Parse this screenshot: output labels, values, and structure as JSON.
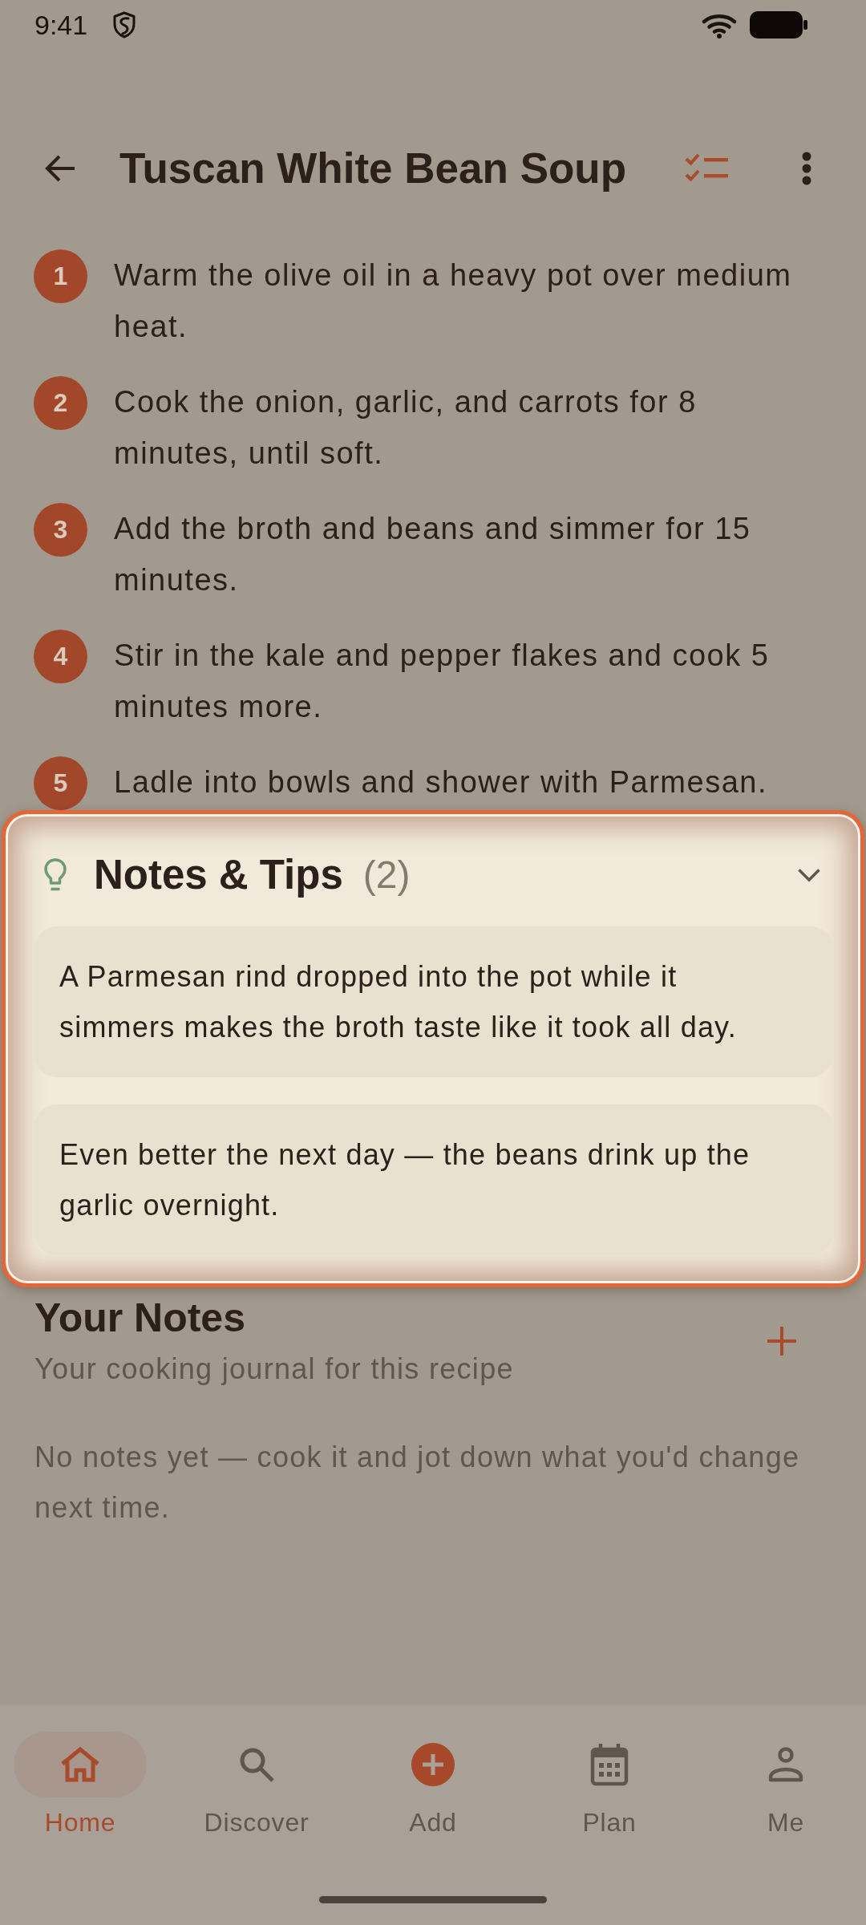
{
  "status_bar": {
    "time": "9:41"
  },
  "app_bar": {
    "title": "Tuscan White Bean Soup"
  },
  "steps": [
    {
      "number": "1",
      "text": "Warm the olive oil in a heavy pot over medium heat."
    },
    {
      "number": "2",
      "text": "Cook the onion, garlic, and carrots for 8 minutes, until soft."
    },
    {
      "number": "3",
      "text": "Add the broth and beans and simmer for 15 minutes."
    },
    {
      "number": "4",
      "text": "Stir in the kale and pepper flakes and cook 5 minutes more."
    },
    {
      "number": "5",
      "text": "Ladle into bowls and shower with Parmesan."
    }
  ],
  "notes_tips": {
    "title": "Notes & Tips",
    "count": "(2)",
    "highlighted": true,
    "expanded": true,
    "tips": [
      "A Parmesan rind dropped into the pot while it simmers makes the broth taste like it took all day.",
      "Even better the next day — the beans drink up the garlic overnight."
    ]
  },
  "your_notes": {
    "title": "Your Notes",
    "subtitle": "Your cooking journal for this recipe",
    "empty_text": "No notes yet — cook it and jot down what you'd change next time."
  },
  "bottom_nav": [
    {
      "label": "Home",
      "selected": true
    },
    {
      "label": "Discover",
      "selected": false
    },
    {
      "label": "Add",
      "selected": false
    },
    {
      "label": "Plan",
      "selected": false
    },
    {
      "label": "Me",
      "selected": false
    }
  ]
}
